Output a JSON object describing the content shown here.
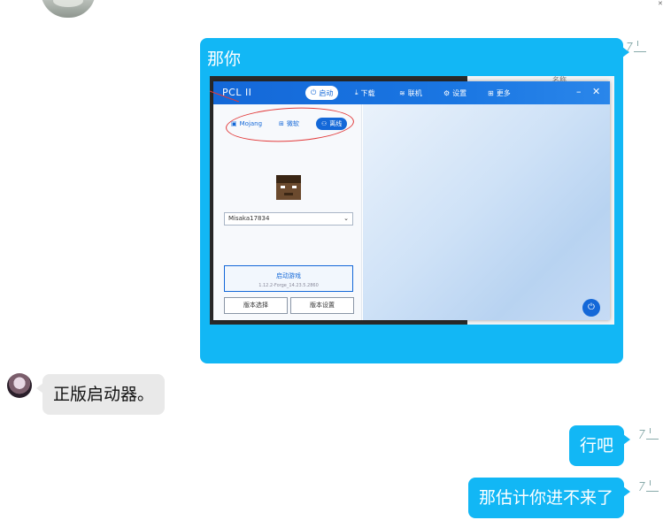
{
  "messages": {
    "m1": {
      "head": "那你",
      "tail": "……"
    },
    "m2": {
      "text": "正版启动器。"
    },
    "m3": {
      "text": "行吧"
    },
    "m4": {
      "text": "那估计你进不来了"
    }
  },
  "screenshot": {
    "app_title": "PCL II",
    "nav": {
      "launch": "启动",
      "download": "下载",
      "online": "联机",
      "settings": "设置",
      "more": "更多"
    },
    "window_controls": {
      "minimize": "–",
      "close": "✕"
    },
    "login_tabs": {
      "mojang": "Mojang",
      "microsoft": "微软",
      "offline": "离线"
    },
    "username": "Misaka17834",
    "launch_button": {
      "label": "启动游戏",
      "version": "1.12.2-Forge_14.23.5.2860"
    },
    "version_select": "版本选择",
    "version_settings": "版本设置",
    "right_panel_label": "名称"
  },
  "colors": {
    "accent": "#12b7f5",
    "pcl_blue": "#1468d8",
    "friend_bubble": "#e9e9e9"
  },
  "icons": [
    "power-icon",
    "download-icon",
    "wifi-icon",
    "gear-icon",
    "grid-icon",
    "user-icon",
    "windows-icon",
    "mojang-icon"
  ]
}
